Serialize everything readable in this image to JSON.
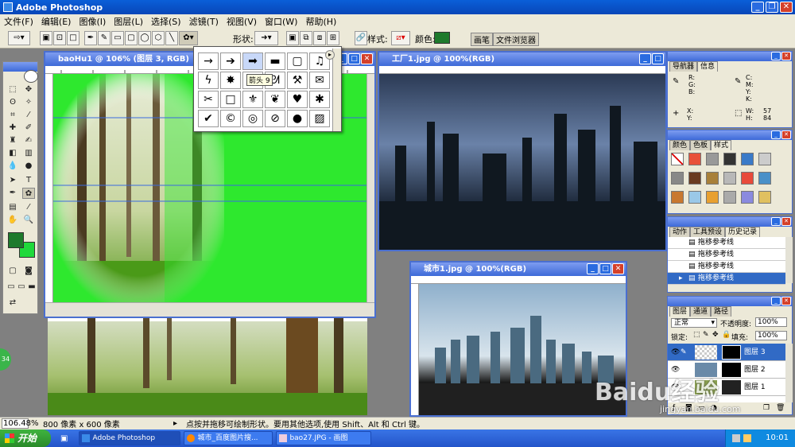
{
  "app": {
    "title": "Adobe Photoshop"
  },
  "menu": [
    "文件(F)",
    "编辑(E)",
    "图像(I)",
    "图层(L)",
    "选择(S)",
    "滤镜(T)",
    "视图(V)",
    "窗口(W)",
    "帮助(H)"
  ],
  "options": {
    "shape_label": "形状:",
    "style_label": "样式:",
    "color_label": "颜色:",
    "color": "#1e7a2c",
    "tab_brush": "画笔",
    "tab_browser": "文件浏览器"
  },
  "colors": {
    "foreground": "#1e7a2c",
    "background": "#1fd93b",
    "green_screen": "#2ee82e"
  },
  "shape_picker": {
    "tooltip": "箭头 9",
    "icons": [
      "arrow-thin-icon",
      "arrow-medium-icon",
      "arrow-bold-icon",
      "banner-icon",
      "frame-icon",
      "music-note-icon",
      "lightning-icon",
      "starburst-icon",
      "grass-icon",
      "footprint-icon",
      "hammer-icon",
      "envelope-icon",
      "scissors-icon",
      "blank-square-icon",
      "fleur-de-lis-icon",
      "paw-icon",
      "heart-icon",
      "splat-icon",
      "checkmark-icon",
      "copyright-icon",
      "target-icon",
      "no-symbol-icon",
      "speech-bubble-icon",
      "diagonal-hatch-icon"
    ]
  },
  "doc1": {
    "title": "baoHu1 @ 106% (图层 3, RGB)"
  },
  "doc2": {
    "title": "工厂1.jpg @ 100%(RGB)"
  },
  "doc3": {
    "title": "城市1.jpg @ 100%(RGB)"
  },
  "navigator": {
    "tabs": [
      "导航器",
      "信息"
    ],
    "labels": {
      "r": "R:",
      "g": "G:",
      "b": "B:",
      "c": "C:",
      "m": "M:",
      "y": "Y:",
      "k": "K:",
      "x": "X:",
      "yy": "Y:",
      "w": "W:",
      "h": "H:"
    },
    "w_value": "57",
    "h_value": "84"
  },
  "swatches": {
    "tabs": [
      "颜色",
      "色板",
      "样式"
    ]
  },
  "history": {
    "tabs": [
      "动作",
      "工具预设",
      "历史记录"
    ],
    "items": [
      "拖移参考线",
      "拖移参考线",
      "拖移参考线",
      "拖移参考线"
    ]
  },
  "layers": {
    "tabs": [
      "图层",
      "通道",
      "路径"
    ],
    "blend_mode": "正常",
    "opacity_label": "不透明度:",
    "opacity": "100%",
    "lock_label": "锁定:",
    "fill_label": "填充:",
    "fill": "100%",
    "items": [
      "图层 3",
      "图层 2",
      "图层 1"
    ]
  },
  "status": {
    "zoom": "106.48%",
    "doc_size": "800 像素 x 600 像素",
    "hint": "点按并拖移可绘制形状。要用其他选项,使用 Shift、Alt 和 Ctrl 键。"
  },
  "taskbar": {
    "start": "开始",
    "tasks": [
      "Adobe Photoshop",
      "城市_百度图片搜...",
      "bao27.JPG - 画图"
    ],
    "clock": "10:01"
  },
  "watermark": {
    "brand": "Baidu经验",
    "url": "jingyan.baidu.com"
  },
  "side_badge": "34"
}
